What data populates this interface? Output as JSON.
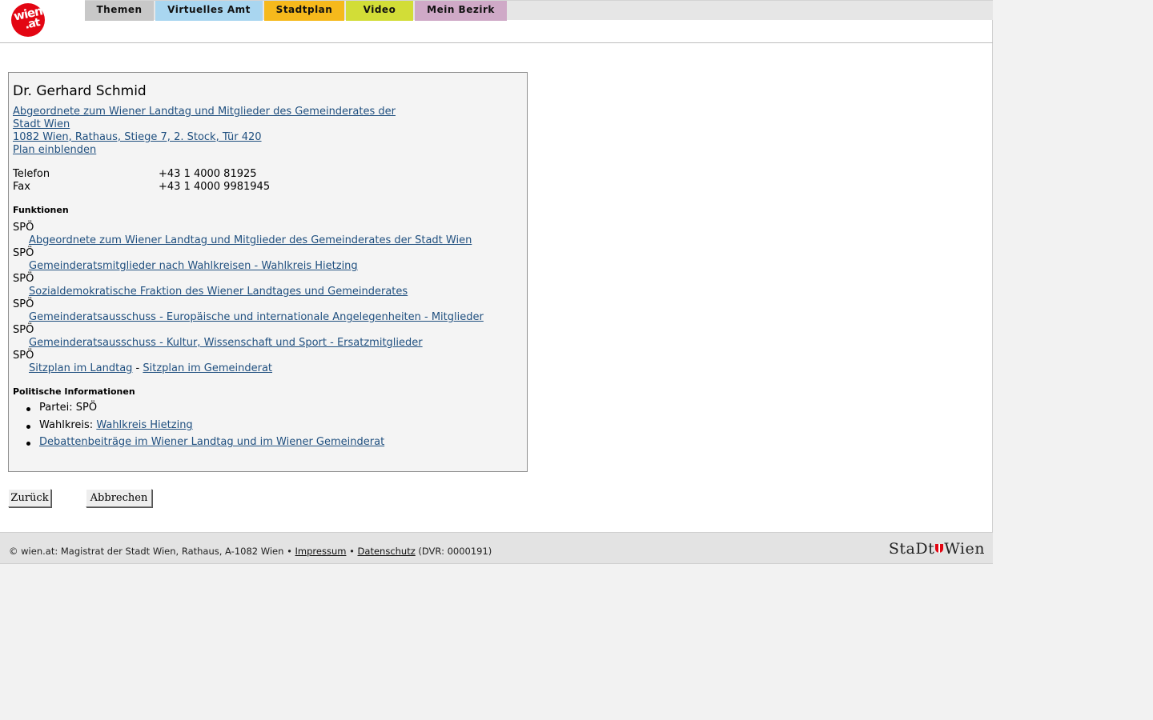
{
  "header": {
    "logo": {
      "line1": "wien",
      "line2": ".at"
    },
    "tabs": [
      {
        "label": "Themen",
        "color": "#c8c8c8"
      },
      {
        "label": "Virtuelles Amt",
        "color": "#a9d6f0"
      },
      {
        "label": "Stadtplan",
        "color": "#f6b91c"
      },
      {
        "label": "Video",
        "color": "#d2dd37"
      },
      {
        "label": "Mein Bezirk",
        "color": "#cfa9c7"
      }
    ]
  },
  "person": {
    "name": "Dr. Gerhard Schmid",
    "org_line1": "Abgeordnete zum Wiener Landtag und Mitglieder des Gemeinderates der",
    "org_line2": "Stadt Wien ",
    "address": "1082 Wien, Rathaus, Stiege 7, 2. Stock, Tür 420",
    "plan_link": "Plan einblenden",
    "phone_label": "Telefon",
    "phone_value": "+43 1 4000 81925",
    "fax_label": "Fax",
    "fax_value": "+43 1 4000 9981945"
  },
  "functions": {
    "heading": "Funktionen",
    "items": [
      {
        "party": "SPÖ",
        "link": "Abgeordnete zum Wiener Landtag und Mitglieder des Gemeinderates der Stadt Wien"
      },
      {
        "party": "SPÖ",
        "link": "Gemeinderatsmitglieder nach Wahlkreisen - Wahlkreis Hietzing"
      },
      {
        "party": "SPÖ",
        "link": "Sozialdemokratische Fraktion des Wiener Landtages und Gemeinderates"
      },
      {
        "party": "SPÖ",
        "link": "Gemeinderatsausschuss - Europäische und internationale Angelegenheiten - Mitglieder"
      },
      {
        "party": "SPÖ",
        "link": "Gemeinderatsausschuss - Kultur, Wissenschaft und Sport - Ersatzmitglieder"
      },
      {
        "party": "SPÖ",
        "link_a": "Sitzplan im Landtag",
        "sep": " - ",
        "link_b": "Sitzplan im Gemeinderat"
      }
    ]
  },
  "political": {
    "heading": "Politische Informationen",
    "party_label": "Partei: ",
    "party_value": "SPÖ",
    "district_label": "Wahlkreis: ",
    "district_link": "Wahlkreis Hietzing",
    "debates_link": "Debattenbeiträge im Wiener Landtag und im Wiener Gemeinderat"
  },
  "buttons": {
    "back": "Zurück",
    "cancel": "Abbrechen"
  },
  "footer": {
    "copyright": "© wien.at: Magistrat der Stadt Wien, Rathaus, A-1082 Wien • ",
    "impressum": "Impressum",
    "bullet": " • ",
    "datenschutz": "Datenschutz",
    "dvr": " (DVR: 0000191)",
    "logo_left": "StaDt",
    "logo_right": "Wien"
  }
}
